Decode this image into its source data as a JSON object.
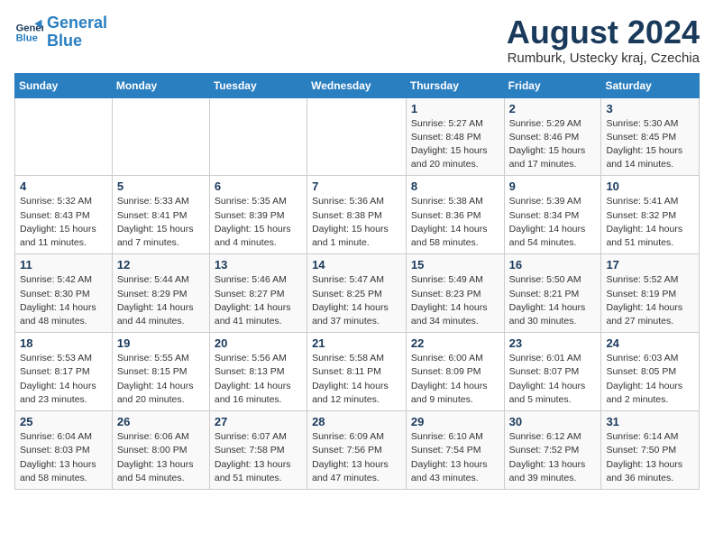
{
  "logo": {
    "line1": "General",
    "line2": "Blue"
  },
  "title": "August 2024",
  "location": "Rumburk, Ustecky kraj, Czechia",
  "days_of_week": [
    "Sunday",
    "Monday",
    "Tuesday",
    "Wednesday",
    "Thursday",
    "Friday",
    "Saturday"
  ],
  "weeks": [
    [
      {
        "num": "",
        "info": ""
      },
      {
        "num": "",
        "info": ""
      },
      {
        "num": "",
        "info": ""
      },
      {
        "num": "",
        "info": ""
      },
      {
        "num": "1",
        "info": "Sunrise: 5:27 AM\nSunset: 8:48 PM\nDaylight: 15 hours\nand 20 minutes."
      },
      {
        "num": "2",
        "info": "Sunrise: 5:29 AM\nSunset: 8:46 PM\nDaylight: 15 hours\nand 17 minutes."
      },
      {
        "num": "3",
        "info": "Sunrise: 5:30 AM\nSunset: 8:45 PM\nDaylight: 15 hours\nand 14 minutes."
      }
    ],
    [
      {
        "num": "4",
        "info": "Sunrise: 5:32 AM\nSunset: 8:43 PM\nDaylight: 15 hours\nand 11 minutes."
      },
      {
        "num": "5",
        "info": "Sunrise: 5:33 AM\nSunset: 8:41 PM\nDaylight: 15 hours\nand 7 minutes."
      },
      {
        "num": "6",
        "info": "Sunrise: 5:35 AM\nSunset: 8:39 PM\nDaylight: 15 hours\nand 4 minutes."
      },
      {
        "num": "7",
        "info": "Sunrise: 5:36 AM\nSunset: 8:38 PM\nDaylight: 15 hours\nand 1 minute."
      },
      {
        "num": "8",
        "info": "Sunrise: 5:38 AM\nSunset: 8:36 PM\nDaylight: 14 hours\nand 58 minutes."
      },
      {
        "num": "9",
        "info": "Sunrise: 5:39 AM\nSunset: 8:34 PM\nDaylight: 14 hours\nand 54 minutes."
      },
      {
        "num": "10",
        "info": "Sunrise: 5:41 AM\nSunset: 8:32 PM\nDaylight: 14 hours\nand 51 minutes."
      }
    ],
    [
      {
        "num": "11",
        "info": "Sunrise: 5:42 AM\nSunset: 8:30 PM\nDaylight: 14 hours\nand 48 minutes."
      },
      {
        "num": "12",
        "info": "Sunrise: 5:44 AM\nSunset: 8:29 PM\nDaylight: 14 hours\nand 44 minutes."
      },
      {
        "num": "13",
        "info": "Sunrise: 5:46 AM\nSunset: 8:27 PM\nDaylight: 14 hours\nand 41 minutes."
      },
      {
        "num": "14",
        "info": "Sunrise: 5:47 AM\nSunset: 8:25 PM\nDaylight: 14 hours\nand 37 minutes."
      },
      {
        "num": "15",
        "info": "Sunrise: 5:49 AM\nSunset: 8:23 PM\nDaylight: 14 hours\nand 34 minutes."
      },
      {
        "num": "16",
        "info": "Sunrise: 5:50 AM\nSunset: 8:21 PM\nDaylight: 14 hours\nand 30 minutes."
      },
      {
        "num": "17",
        "info": "Sunrise: 5:52 AM\nSunset: 8:19 PM\nDaylight: 14 hours\nand 27 minutes."
      }
    ],
    [
      {
        "num": "18",
        "info": "Sunrise: 5:53 AM\nSunset: 8:17 PM\nDaylight: 14 hours\nand 23 minutes."
      },
      {
        "num": "19",
        "info": "Sunrise: 5:55 AM\nSunset: 8:15 PM\nDaylight: 14 hours\nand 20 minutes."
      },
      {
        "num": "20",
        "info": "Sunrise: 5:56 AM\nSunset: 8:13 PM\nDaylight: 14 hours\nand 16 minutes."
      },
      {
        "num": "21",
        "info": "Sunrise: 5:58 AM\nSunset: 8:11 PM\nDaylight: 14 hours\nand 12 minutes."
      },
      {
        "num": "22",
        "info": "Sunrise: 6:00 AM\nSunset: 8:09 PM\nDaylight: 14 hours\nand 9 minutes."
      },
      {
        "num": "23",
        "info": "Sunrise: 6:01 AM\nSunset: 8:07 PM\nDaylight: 14 hours\nand 5 minutes."
      },
      {
        "num": "24",
        "info": "Sunrise: 6:03 AM\nSunset: 8:05 PM\nDaylight: 14 hours\nand 2 minutes."
      }
    ],
    [
      {
        "num": "25",
        "info": "Sunrise: 6:04 AM\nSunset: 8:03 PM\nDaylight: 13 hours\nand 58 minutes."
      },
      {
        "num": "26",
        "info": "Sunrise: 6:06 AM\nSunset: 8:00 PM\nDaylight: 13 hours\nand 54 minutes."
      },
      {
        "num": "27",
        "info": "Sunrise: 6:07 AM\nSunset: 7:58 PM\nDaylight: 13 hours\nand 51 minutes."
      },
      {
        "num": "28",
        "info": "Sunrise: 6:09 AM\nSunset: 7:56 PM\nDaylight: 13 hours\nand 47 minutes."
      },
      {
        "num": "29",
        "info": "Sunrise: 6:10 AM\nSunset: 7:54 PM\nDaylight: 13 hours\nand 43 minutes."
      },
      {
        "num": "30",
        "info": "Sunrise: 6:12 AM\nSunset: 7:52 PM\nDaylight: 13 hours\nand 39 minutes."
      },
      {
        "num": "31",
        "info": "Sunrise: 6:14 AM\nSunset: 7:50 PM\nDaylight: 13 hours\nand 36 minutes."
      }
    ]
  ]
}
